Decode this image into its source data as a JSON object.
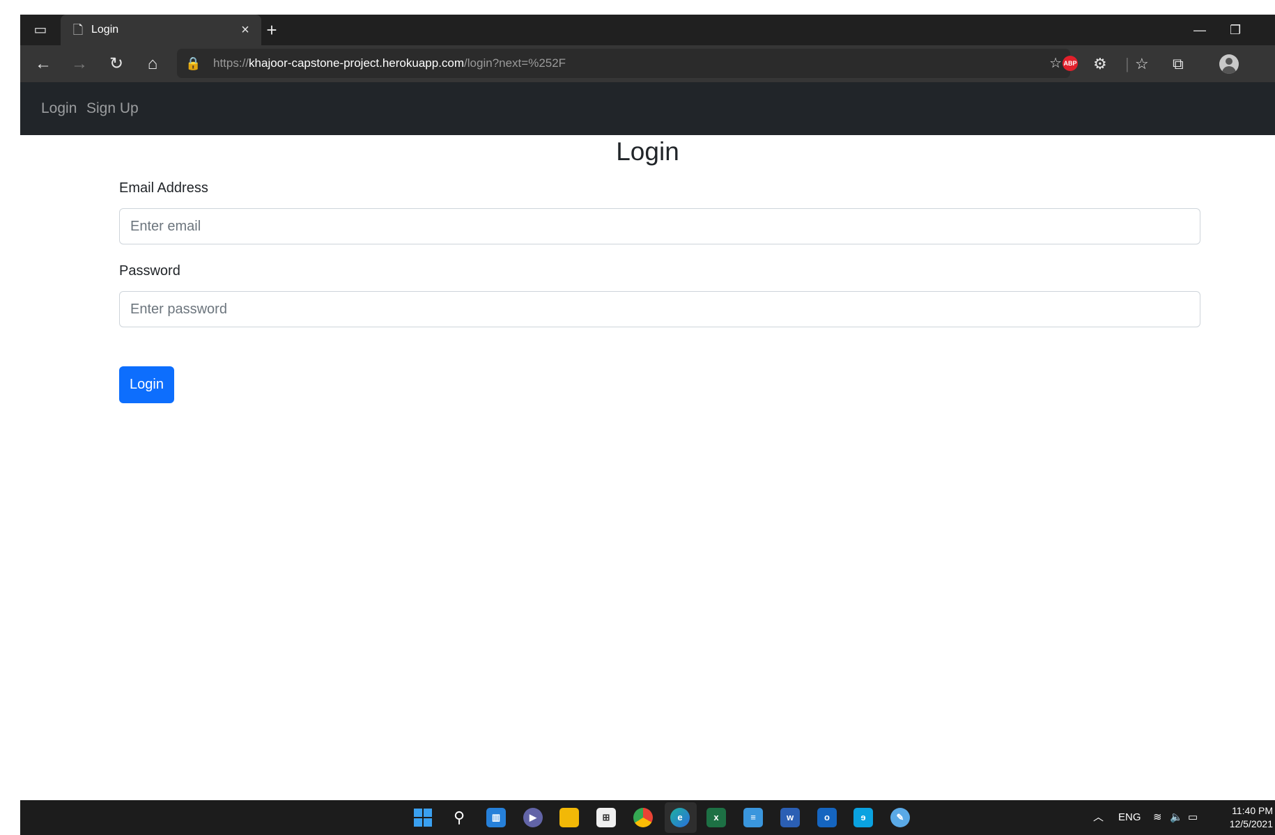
{
  "browser": {
    "tab_title": "Login",
    "url_scheme": "https://",
    "url_host": "khajoor-capstone-project.herokuapp.com",
    "url_path": "/login?next=%252F"
  },
  "navbar": {
    "items": [
      {
        "label": "Login"
      },
      {
        "label": "Sign Up"
      }
    ]
  },
  "form": {
    "title": "Login",
    "email_label": "Email Address",
    "email_placeholder": "Enter email",
    "password_label": "Password",
    "password_placeholder": "Enter password",
    "submit_label": "Login",
    "accent_color": "#0d6efd"
  },
  "taskbar": {
    "language": "ENG",
    "time": "11:40 PM",
    "date": "12/5/2021",
    "apps": [
      "start-icon",
      "search-icon",
      "widgets-icon",
      "teams-chat-icon",
      "file-explorer-icon",
      "store-icon",
      "chrome-icon",
      "edge-icon",
      "excel-icon",
      "notepad-icon",
      "word-icon",
      "outlook-icon",
      "sticky-icon",
      "paint-icon"
    ]
  }
}
